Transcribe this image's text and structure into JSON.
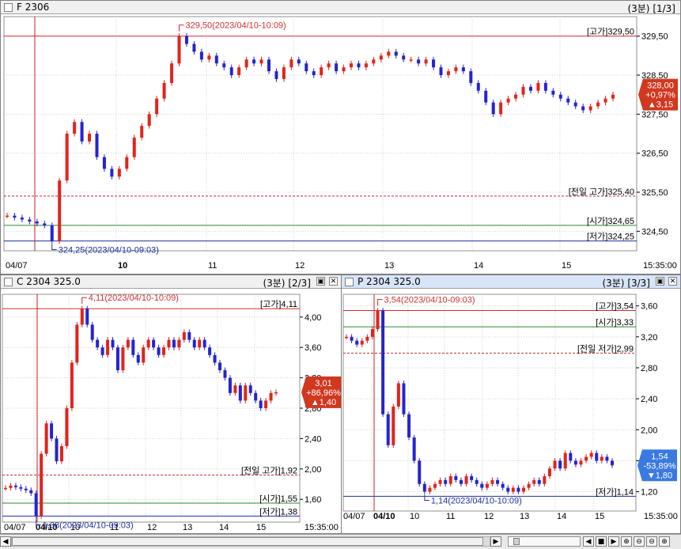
{
  "colors": {
    "up": "#e0241d",
    "down": "#2424d0",
    "high_line": "#d03030",
    "open_line": "#2a8a2a",
    "low_line": "#2030a0",
    "prev_line": "#c03030",
    "grid": "#d0d0d0"
  },
  "panels": [
    {
      "title": "F 2306",
      "interval": "(3분)",
      "page": "[1/3]",
      "price_labels": [
        "329,50",
        "328,50",
        "327,50",
        "326,50",
        "325,50",
        "324,50"
      ],
      "price_values": [
        329.5,
        328.5,
        327.5,
        326.5,
        325.5,
        324.5
      ],
      "ymin": 324.0,
      "ymax": 330.0,
      "date_labels": [
        "04/07",
        "10",
        "11",
        "12",
        "13",
        "14",
        "15"
      ],
      "end_time": "15:35:00",
      "high_note": "329,50(2023/04/10-10:09)",
      "low_note": "324,25(2023/04/10-09:03)",
      "ref_lines": [
        {
          "label": "[고가]329,50",
          "value": 329.5,
          "kind": "high"
        },
        {
          "label": "[전일 고가]325,40",
          "value": 325.4,
          "kind": "prev"
        },
        {
          "label": "[시가]324,65",
          "value": 324.65,
          "kind": "open"
        },
        {
          "label": "[저가]324,25",
          "value": 324.25,
          "kind": "low"
        }
      ],
      "current": {
        "price": "328,00",
        "pct": "+0,97%",
        "change": "▲3,15",
        "value": 328.0,
        "dir": "up"
      },
      "series": [
        324.9,
        324.85,
        324.8,
        324.75,
        324.7,
        324.65,
        324.25,
        325.8,
        327.0,
        327.3,
        326.8,
        327.0,
        326.4,
        326.1,
        325.9,
        326.1,
        326.4,
        326.9,
        327.2,
        327.5,
        327.9,
        328.3,
        328.8,
        329.5,
        329.3,
        329.1,
        328.9,
        329.0,
        328.8,
        328.7,
        328.5,
        328.7,
        328.9,
        328.8,
        328.9,
        328.6,
        328.4,
        328.7,
        328.9,
        328.8,
        328.6,
        328.5,
        328.7,
        328.8,
        328.6,
        328.7,
        328.8,
        328.7,
        328.8,
        328.9,
        329.0,
        329.1,
        329.0,
        328.9,
        328.9,
        328.8,
        328.9,
        328.7,
        328.5,
        328.6,
        328.7,
        328.6,
        328.3,
        328.1,
        327.8,
        327.5,
        327.8,
        327.9,
        328.0,
        328.2,
        328.1,
        328.3,
        328.1,
        328.0,
        327.9,
        327.8,
        327.7,
        327.6,
        327.7,
        327.8,
        327.9,
        328.0
      ]
    },
    {
      "title": "C 2304 325.0",
      "interval": "(3분)",
      "page": "[2/3]",
      "price_labels": [
        "4,00",
        "3,60",
        "3,20",
        "2,80",
        "2,40",
        "2,00",
        "1,60"
      ],
      "price_values": [
        4.0,
        3.6,
        3.2,
        2.8,
        2.4,
        2.0,
        1.6
      ],
      "ymin": 1.3,
      "ymax": 4.3,
      "date_labels": [
        "04/07",
        "04/10",
        "10",
        "11",
        "12",
        "13",
        "14",
        "15"
      ],
      "end_time": "15:35:00",
      "high_note": "4,11(2023/04/10-10:09)",
      "low_note": "1,38(2023/04/10-09:03)",
      "ref_lines": [
        {
          "label": "[고가]4,11",
          "value": 4.11,
          "kind": "high"
        },
        {
          "label": "[전일 고가]1,92",
          "value": 1.92,
          "kind": "prev"
        },
        {
          "label": "[시가]1,55",
          "value": 1.55,
          "kind": "open"
        },
        {
          "label": "[저가]1,38",
          "value": 1.38,
          "kind": "low"
        }
      ],
      "current": {
        "price": "3,01",
        "pct": "+86,96%",
        "change": "▲1,40",
        "value": 3.01,
        "dir": "up"
      },
      "series": [
        1.75,
        1.78,
        1.76,
        1.74,
        1.72,
        1.68,
        1.38,
        2.2,
        2.6,
        2.4,
        2.1,
        2.3,
        2.8,
        3.4,
        3.9,
        4.11,
        3.9,
        3.7,
        3.6,
        3.5,
        3.7,
        3.6,
        3.3,
        3.6,
        3.7,
        3.5,
        3.4,
        3.6,
        3.7,
        3.6,
        3.5,
        3.6,
        3.7,
        3.6,
        3.7,
        3.8,
        3.7,
        3.6,
        3.7,
        3.6,
        3.5,
        3.4,
        3.3,
        3.2,
        3.0,
        3.1,
        2.9,
        3.1,
        3.0,
        2.9,
        2.8,
        2.9,
        3.0,
        3.01
      ]
    },
    {
      "title": "P 2304 325.0",
      "interval": "(3분)",
      "page": "[3/3]",
      "price_labels": [
        "3,60",
        "3,20",
        "2,80",
        "2,40",
        "2,00",
        "1,60",
        "1,20"
      ],
      "price_values": [
        3.6,
        3.2,
        2.8,
        2.4,
        2.0,
        1.6,
        1.2
      ],
      "ymin": 0.95,
      "ymax": 3.75,
      "date_labels": [
        "04/07",
        "04/10",
        "10",
        "11",
        "12",
        "13",
        "14",
        "15"
      ],
      "end_time": "15:35:00",
      "high_note": "3,54(2023/04/10-09:03)",
      "low_note": "1,14(2023/04/10-10:09)",
      "ref_lines": [
        {
          "label": "[고가]3,54",
          "value": 3.54,
          "kind": "high"
        },
        {
          "label": "[시가]3,33",
          "value": 3.33,
          "kind": "open"
        },
        {
          "label": "[전일 저가]2,99",
          "value": 2.99,
          "kind": "prev"
        },
        {
          "label": "[저가]1,14",
          "value": 1.14,
          "kind": "low"
        }
      ],
      "current": {
        "price": "1,54",
        "pct": "-53,89%",
        "change": "▼1,80",
        "value": 1.54,
        "dir": "down"
      },
      "series": [
        3.2,
        3.15,
        3.1,
        3.15,
        3.2,
        3.3,
        3.54,
        2.2,
        1.8,
        2.3,
        2.6,
        2.2,
        1.9,
        1.6,
        1.3,
        1.2,
        1.25,
        1.3,
        1.35,
        1.3,
        1.4,
        1.35,
        1.3,
        1.4,
        1.35,
        1.3,
        1.25,
        1.3,
        1.35,
        1.3,
        1.25,
        1.2,
        1.25,
        1.2,
        1.25,
        1.3,
        1.35,
        1.3,
        1.4,
        1.5,
        1.6,
        1.5,
        1.7,
        1.6,
        1.55,
        1.6,
        1.65,
        1.7,
        1.6,
        1.65,
        1.6,
        1.54
      ]
    }
  ],
  "scrollbar": {
    "left": "◀",
    "right": "▶",
    "zoom_buttons": [
      "◀",
      "■",
      "▶",
      "⊕",
      "⊖",
      "⊖",
      "⊕",
      "⊘"
    ]
  }
}
